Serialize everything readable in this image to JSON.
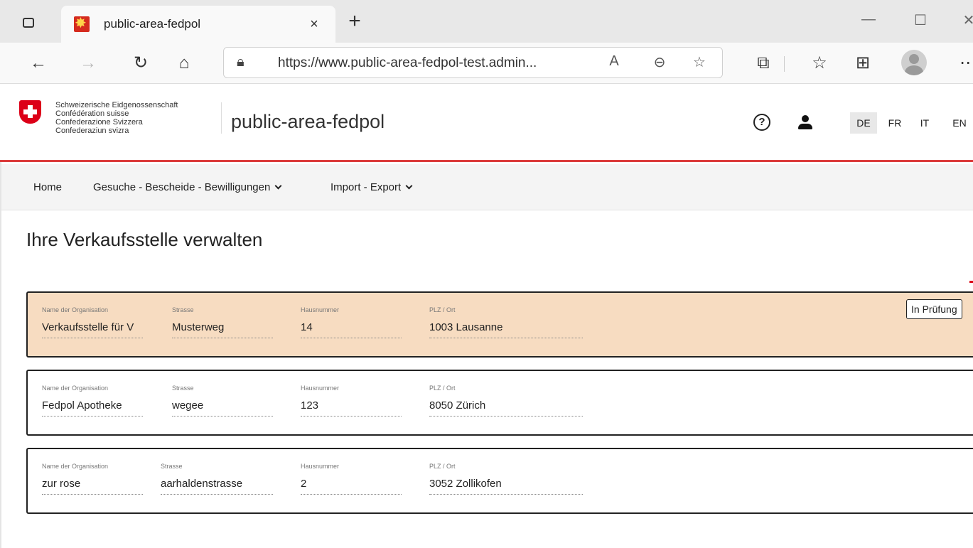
{
  "browser": {
    "tab_title": "public-area-fedpol",
    "tab_close": "×",
    "new_tab": "+",
    "url": "https://www.public-area-fedpol-test.admin...",
    "window_minimize": "—",
    "window_maximize": "☐",
    "window_close": "✕"
  },
  "header": {
    "confederation": [
      "Schweizerische Eidgenossenschaft",
      "Confédération suisse",
      "Confederazione Svizzera",
      "Confederaziun svizra"
    ],
    "site_title": "public-area-fedpol",
    "help": "?",
    "languages": [
      "DE",
      "FR",
      "IT",
      "EN"
    ],
    "active_language": "DE"
  },
  "nav": {
    "items": [
      "Home",
      "Gesuche - Bescheide - Bewilligungen",
      "Import - Export"
    ]
  },
  "main": {
    "title": "Ihre Verkaufsstelle verwalten",
    "field_labels": {
      "name": "Name der Organisation",
      "street": "Strasse",
      "number": "Hausnummer",
      "city": "PLZ / Ort"
    },
    "cards": [
      {
        "name": "Verkaufsstelle für V",
        "street": "Musterweg",
        "number": "14",
        "city": "1003 Lausanne",
        "status": "In Prüfung",
        "highlight": true
      },
      {
        "name": "Fedpol Apotheke",
        "street": "wegee",
        "number": "123",
        "city": "8050 Zürich"
      },
      {
        "name": "zur rose",
        "street": "aarhaldenstrasse",
        "number": "2",
        "city": "3052 Zollikofen"
      }
    ]
  },
  "colors": {
    "swiss_red": "#dc0018",
    "header_rule": "#dc3c3c",
    "highlight_card": "#f7dcc1"
  }
}
